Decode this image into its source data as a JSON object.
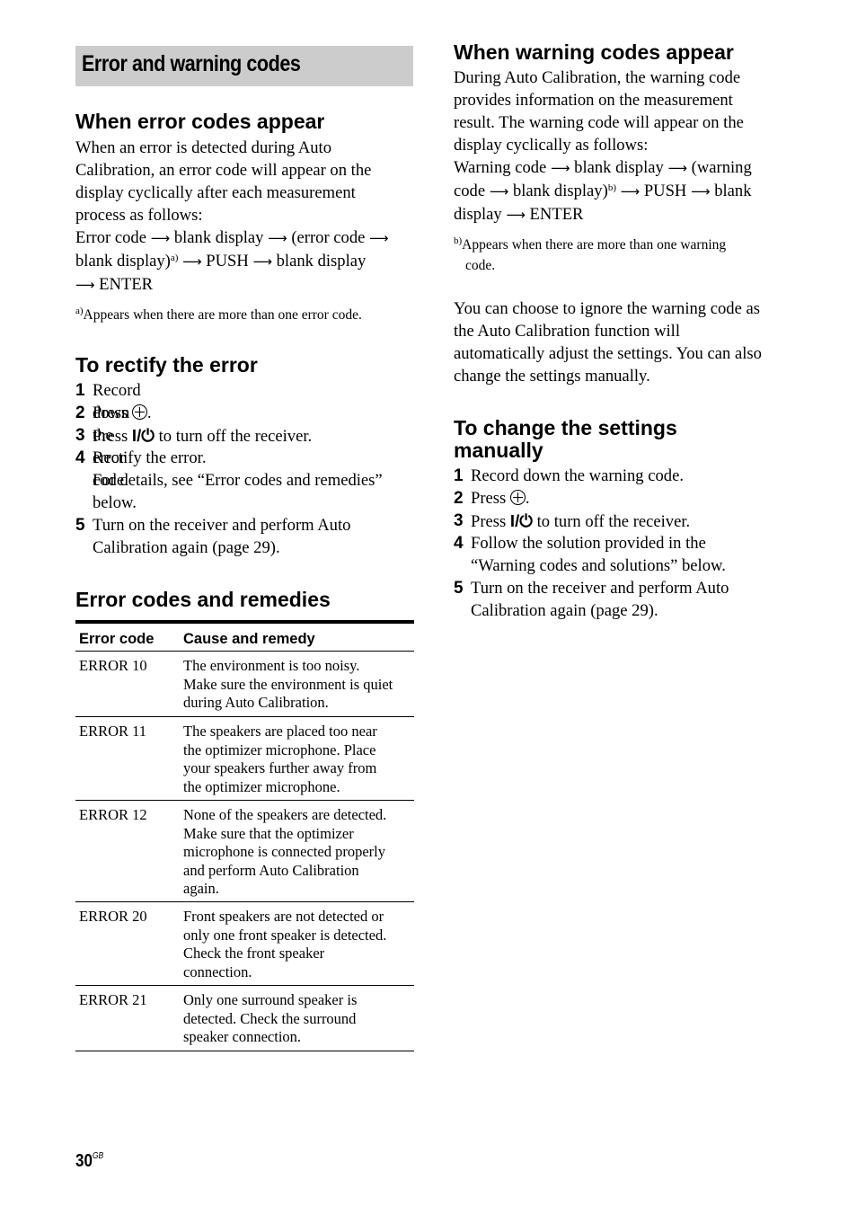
{
  "banner": {
    "title": "Error and warning codes"
  },
  "left": {
    "error_heading": "When error codes appear",
    "error_intro": [
      "When an error is detected during Auto",
      "Calibration, an error code will appear on the",
      "display cyclically after each measurement",
      "process as follows:"
    ],
    "sequence": {
      "line1": [
        "Error code",
        "blank display",
        "(error code"
      ],
      "line2": [
        "blank display)",
        "a)",
        "PUSH",
        "blank display"
      ],
      "line3": [
        "ENTER"
      ]
    },
    "footnote": {
      "mark": "a)",
      "text": "Appears when there are more than one error code."
    },
    "rectify_heading": "To rectify the error",
    "steps": [
      {
        "num": "1",
        "lines": [
          "Record down the error code."
        ]
      },
      {
        "num": "2",
        "pre": "Press",
        "icon": "enter-icon",
        "post": "."
      },
      {
        "num": "3",
        "pre": "Press",
        "icon": "power-icon",
        "icon_text": "I/⏻",
        "post": "to turn off the receiver."
      },
      {
        "num": "4",
        "lines": [
          "Rectify the error.",
          "For details, see “Error codes and remedies”",
          "below."
        ]
      },
      {
        "num": "5",
        "lines": [
          "Turn on the receiver and perform Auto",
          "Calibration again (page 29)."
        ]
      }
    ],
    "remedies_heading": "Error codes and remedies",
    "table": {
      "headers": [
        "Error code",
        "Cause and remedy"
      ],
      "rows": [
        {
          "code": "ERROR 10",
          "lines": [
            "The environment is too noisy.",
            "Make sure the environment is quiet",
            "during Auto Calibration."
          ]
        },
        {
          "code": "ERROR 11",
          "lines": [
            "The speakers are placed too near",
            "the optimizer microphone. Place",
            "your speakers further away from",
            "the optimizer microphone."
          ]
        },
        {
          "code": "ERROR 12",
          "lines": [
            "None of the speakers are detected.",
            "Make sure that the optimizer",
            "microphone is connected properly",
            "and perform Auto Calibration",
            "again."
          ]
        },
        {
          "code": "ERROR 20",
          "lines": [
            "Front speakers are not detected or",
            "only one front speaker is detected.",
            "Check the front speaker",
            "connection."
          ]
        },
        {
          "code": "ERROR 21",
          "lines": [
            "Only one surround speaker is",
            "detected. Check the surround",
            "speaker connection."
          ]
        }
      ]
    }
  },
  "right": {
    "warning_heading": "When warning codes appear",
    "warning_intro": [
      "During Auto Calibration, the warning code",
      "provides information on the measurement",
      "result. The warning code will appear on the",
      "display cyclically as follows:"
    ],
    "sequence": {
      "line1": [
        "Warning code",
        "blank display",
        "(warning"
      ],
      "line2": [
        "code",
        "blank display)",
        "b)",
        "PUSH",
        "blank"
      ],
      "line3": [
        "display",
        "ENTER"
      ]
    },
    "footnote": {
      "mark": "b)",
      "lines": [
        "Appears when there are more than one warning",
        "code."
      ]
    },
    "ignore_text": [
      "You can choose to ignore the warning code as",
      "the Auto Calibration function will",
      "automatically adjust the settings. You can also",
      "change the settings manually."
    ],
    "change_heading": [
      "To change the settings",
      "manually"
    ],
    "steps": [
      {
        "num": "1",
        "lines": [
          "Record down the warning code."
        ]
      },
      {
        "num": "2",
        "pre": "Press",
        "icon": "enter-icon",
        "post": "."
      },
      {
        "num": "3",
        "pre": "Press",
        "icon": "power-icon",
        "icon_text": "I/⏻",
        "post": "to turn off the receiver."
      },
      {
        "num": "4",
        "lines": [
          "Follow the solution provided in the",
          "“Warning codes and solutions” below."
        ]
      },
      {
        "num": "5",
        "lines": [
          "Turn on the receiver and perform Auto",
          "Calibration again (page 29)."
        ]
      }
    ]
  },
  "footer": {
    "page_number": "30",
    "region": "GB"
  },
  "arrow": "⟶"
}
